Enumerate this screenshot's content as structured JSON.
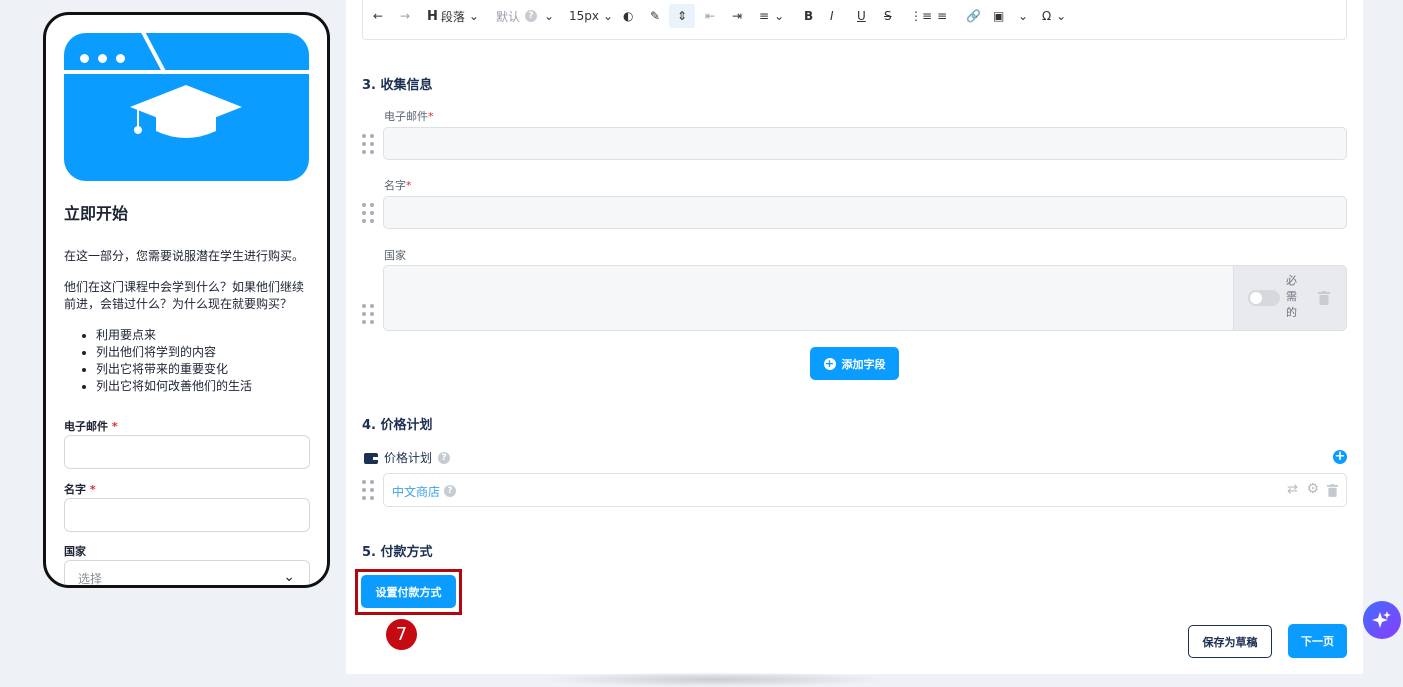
{
  "preview": {
    "title": "立即开始",
    "paragraph1": "在这一部分，您需要说服潜在学生进行购买。",
    "paragraph2": "他们在这门课程中会学到什么？如果他们继续前进，会错过什么？为什么现在就要购买？",
    "bullets": [
      "利用要点来",
      "列出他们将学到的内容",
      "列出它将带来的重要变化",
      "列出它将如何改善他们的生活"
    ],
    "email_label": "电子邮件",
    "name_label": "名字",
    "required_mark": "*",
    "country_label": "国家",
    "country_placeholder": "选择"
  },
  "toolbar": {
    "paragraph_label": "段落",
    "font_label": "默认",
    "font_size": "15px",
    "icons": [
      "undo-icon",
      "redo-icon",
      "heading-icon",
      "font-icon",
      "font-size-icon",
      "text-color-icon",
      "highlight-icon",
      "line-height-icon",
      "outdent-icon",
      "indent-icon",
      "align-icon",
      "bold-icon",
      "italic-icon",
      "underline-icon",
      "strikethrough-icon",
      "bullet-list-icon",
      "numbered-list-icon",
      "link-icon",
      "image-icon",
      "special-char-icon"
    ]
  },
  "sections": {
    "collect_title": "3. 收集信息",
    "email_label": "电子邮件",
    "name_label": "名字",
    "required_mark": "*",
    "country_label": "国家",
    "required_toggle_label": "必需的",
    "add_field_label": "添加字段",
    "pricing_title": "4. 价格计划",
    "pricing_plan_label": "价格计划",
    "plan_name": "中文商店",
    "payment_title": "5. 付款方式",
    "set_payment_label": "设置付款方式"
  },
  "annotation": {
    "step_number": "7"
  },
  "footer": {
    "save_draft_label": "保存为草稿",
    "next_page_label": "下一页"
  },
  "colors": {
    "accent": "#0a9cff",
    "navy": "#1c2f54",
    "highlight_red": "#b3060f"
  }
}
